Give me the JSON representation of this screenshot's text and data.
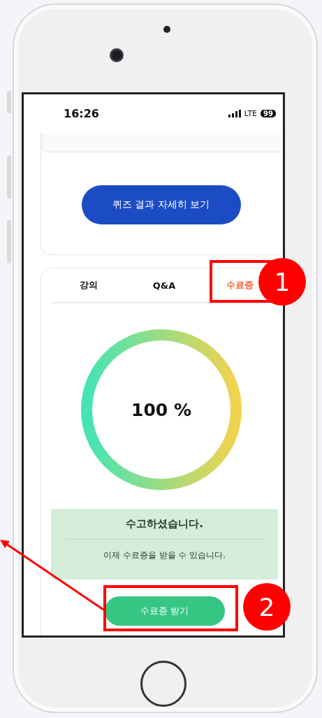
{
  "status_bar": {
    "time": "16:26",
    "network": "LTE",
    "battery": "99"
  },
  "quiz_card": {
    "button": "퀴즈 결과 자세히 보기"
  },
  "tabs": [
    {
      "label": "강의",
      "selected": false
    },
    {
      "label": "Q&A",
      "selected": false
    },
    {
      "label": "수료증",
      "selected": true
    }
  ],
  "progress": {
    "level": 1,
    "reading": "100 %"
  },
  "message": {
    "title": "수고하셨습니다.",
    "text": "이제 수료증을 받을 수 있습니다."
  },
  "certificate_button": "수료증 받기",
  "annotations": [
    {
      "label": "1"
    },
    {
      "label": "2"
    }
  ]
}
